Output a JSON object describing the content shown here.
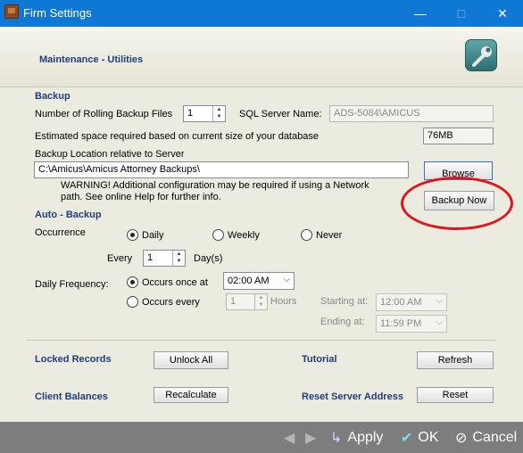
{
  "window": {
    "title": "Firm Settings"
  },
  "header": {
    "section": "Maintenance - Utilities"
  },
  "backup": {
    "title": "Backup",
    "rolling_label": "Number of Rolling Backup Files",
    "rolling_value": "1",
    "sql_label": "SQL Server Name:",
    "sql_value": "ADS-5084\\AMICUS",
    "estimate_label": "Estimated space required based on current size of your database",
    "estimate_value": "76MB",
    "location_label": "Backup Location relative to Server",
    "location_value": "C:\\Amicus\\Amicus Attorney Backups\\",
    "browse_label": "Browse",
    "warning_line1": "WARNING! Additional configuration may be required if using a Network",
    "warning_line2": "path. See online Help for further info.",
    "backup_now_label": "Backup Now"
  },
  "auto_backup": {
    "title": "Auto - Backup",
    "occurrence_label": "Occurrence",
    "daily": "Daily",
    "weekly": "Weekly",
    "never": "Never",
    "selected_occurrence": "Daily",
    "every_label": "Every",
    "every_value": "1",
    "days_label": "Day(s)",
    "frequency_label": "Daily Frequency:",
    "once_label": "Occurs once at",
    "once_time": "02:00 AM",
    "every_freq_label": "Occurs every",
    "every_freq_value": "1",
    "hours_label": "Hours",
    "starting_label": "Starting at:",
    "starting_value": "12:00 AM",
    "ending_label": "Ending at:",
    "ending_value": "11:59 PM"
  },
  "utilities": {
    "locked_records": "Locked Records",
    "unlock_all": "Unlock All",
    "tutorial": "Tutorial",
    "refresh": "Refresh",
    "client_balances": "Client Balances",
    "recalculate": "Recalculate",
    "reset_server": "Reset Server Address",
    "reset": "Reset"
  },
  "footer": {
    "apply": "Apply",
    "ok": "OK",
    "cancel": "Cancel"
  },
  "colors": {
    "titlebar": "#0f78d4",
    "section_title": "#1f3e7a",
    "highlight_circle": "#e0151b",
    "footer_bar": "#7d7d7d"
  },
  "icons": [
    "app-icon",
    "minimize-icon",
    "maximize-icon",
    "close-icon",
    "wrench-icon",
    "back-arrow-icon",
    "forward-arrow-icon",
    "apply-icon",
    "ok-check-icon",
    "cancel-icon"
  ]
}
